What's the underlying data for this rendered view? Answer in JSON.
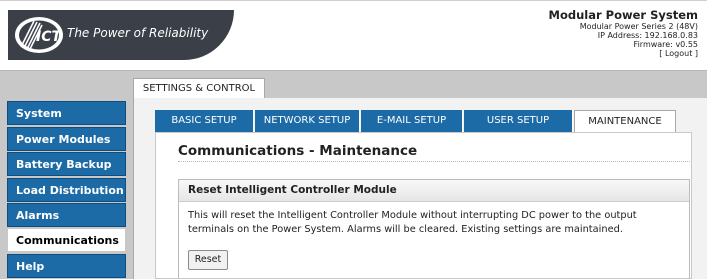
{
  "header": {
    "logo_text": "The Power of Reliability",
    "logo_mark": "ICT",
    "system_title": "Modular Power System",
    "system_model": "Modular Power Series 2 (48V)",
    "ip_address": "IP Address: 192.168.0.83",
    "firmware": "Firmware: v0.55",
    "logout": "[ Logout ]"
  },
  "outer_tab": {
    "label": "SETTINGS & CONTROL"
  },
  "sidebar": {
    "items": [
      {
        "label": "System",
        "active": false
      },
      {
        "label": "Power Modules",
        "active": false
      },
      {
        "label": "Battery Backup",
        "active": false
      },
      {
        "label": "Load Distribution",
        "active": false
      },
      {
        "label": "Alarms",
        "active": false
      },
      {
        "label": "Communications",
        "active": true
      },
      {
        "label": "Help",
        "active": false
      }
    ]
  },
  "tabs": [
    {
      "label": "BASIC SETUP",
      "active": false
    },
    {
      "label": "NETWORK SETUP",
      "active": false
    },
    {
      "label": "E-MAIL SETUP",
      "active": false
    },
    {
      "label": "USER SETUP",
      "active": false
    },
    {
      "label": "MAINTENANCE",
      "active": true
    }
  ],
  "main": {
    "title": "Communications - Maintenance",
    "section": {
      "heading": "Reset Intelligent Controller Module",
      "text": "This will reset the Intelligent Controller Module without interrupting DC power to the output terminals on the Power System. Alarms will be cleared. Existing settings are maintained.",
      "button_label": "Reset"
    }
  },
  "colors": {
    "nav_blue": "#1c6aa6",
    "band_gray": "#c8c8c8",
    "logo_dark": "#3b3f48"
  }
}
